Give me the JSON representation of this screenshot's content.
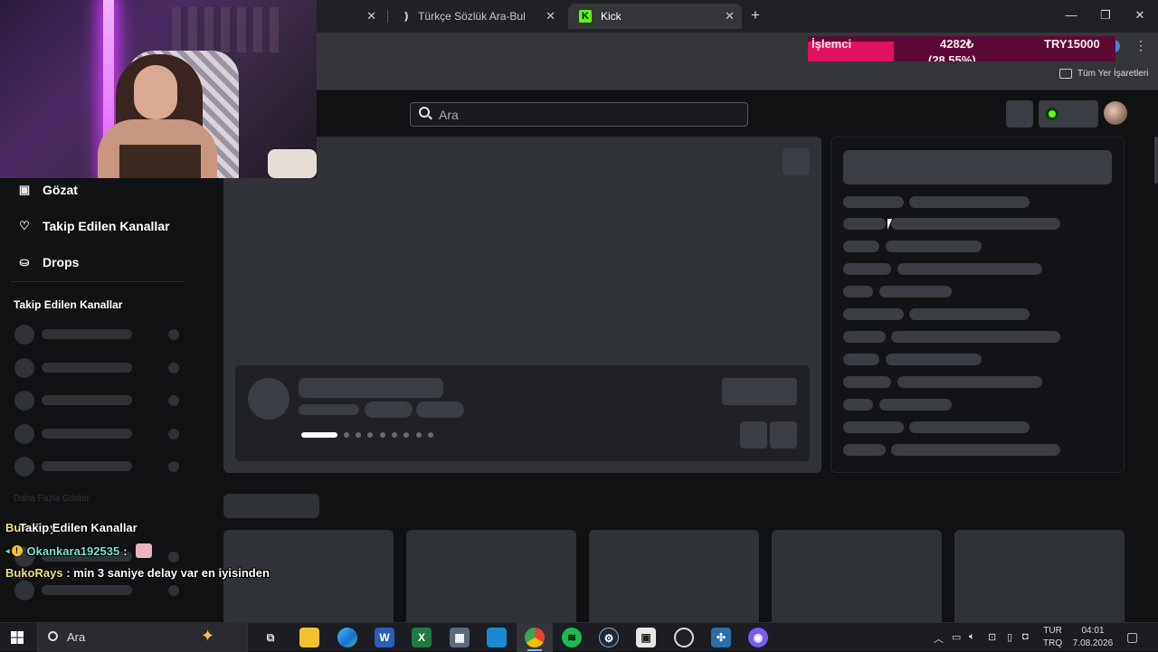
{
  "browser": {
    "tabs": [
      {
        "title": "",
        "active": false
      },
      {
        "title": "Türkçe Sözlük Ara-Bul",
        "active": false
      },
      {
        "title": "Kick",
        "active": true
      }
    ],
    "new_tab_label": "+",
    "bookmarks_folder_label": "Tüm Yer İşaretleri"
  },
  "stock_widget": {
    "name": "İşlemci",
    "price": "4282₺",
    "change": "(28.55%)",
    "target": "TRY15000"
  },
  "site": {
    "search_placeholder": "Ara",
    "accent_color": "#53fc18",
    "sidebar": {
      "nav": [
        {
          "label": "Gözat",
          "icon": "browse-icon"
        },
        {
          "label": "Takip Edilen Kanallar",
          "icon": "heart-icon"
        },
        {
          "label": "Drops",
          "icon": "drops-icon"
        }
      ],
      "section_title": "Takip Edilen Kanallar",
      "show_more": "Daha Fazla Göster"
    }
  },
  "chat_overlay": {
    "lines": [
      {
        "user": "BukoRays",
        "text": "Takip Edilen Kanallar"
      },
      {
        "user": "Okankara192535",
        "text": ":"
      },
      {
        "user": "BukoRays",
        "text": ": min 3 saniye delay var en iyisinden"
      }
    ]
  },
  "taskbar": {
    "search_placeholder": "Ara",
    "lang_top": "TUR",
    "lang_bottom": "TRQ",
    "time": "04:01",
    "date": "7.08.2026"
  }
}
